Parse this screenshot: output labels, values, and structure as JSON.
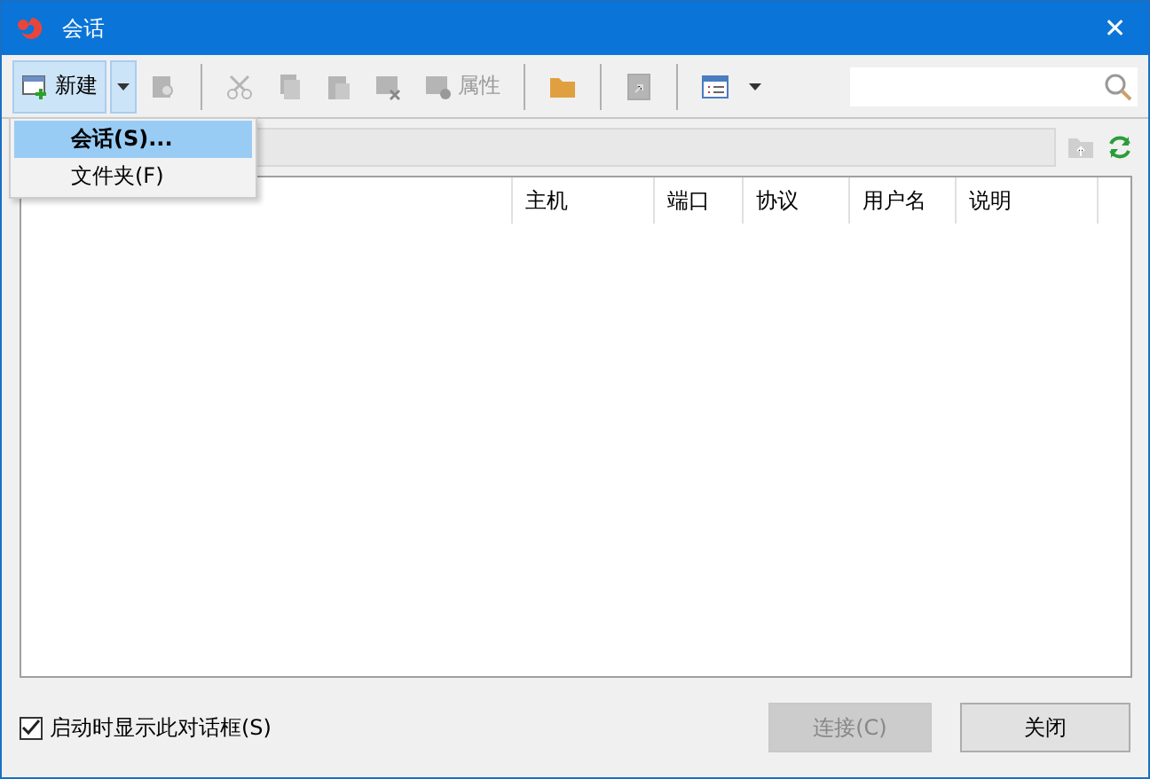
{
  "window": {
    "title": "会话",
    "close": "✕"
  },
  "toolbar": {
    "items": [
      {
        "kind": "new",
        "label": "新建",
        "pressed": true,
        "disabled": false
      },
      {
        "kind": "dropdown",
        "pressed": true,
        "disabled": false
      },
      {
        "kind": "find",
        "disabled": true
      },
      {
        "kind": "separator"
      },
      {
        "kind": "cut",
        "disabled": true
      },
      {
        "kind": "copy",
        "disabled": true
      },
      {
        "kind": "paste",
        "disabled": true
      },
      {
        "kind": "delete",
        "disabled": true
      },
      {
        "kind": "properties",
        "label": "属性",
        "disabled": true
      },
      {
        "kind": "separator"
      },
      {
        "kind": "folder",
        "disabled": false
      },
      {
        "kind": "separator"
      },
      {
        "kind": "shortcut",
        "disabled": true
      },
      {
        "kind": "separator"
      },
      {
        "kind": "view"
      },
      {
        "kind": "dropdown",
        "pressed": false
      }
    ]
  },
  "menu": {
    "items": [
      {
        "label": "会话(S)...",
        "selected": true
      },
      {
        "label": "文件夹(F)",
        "selected": false
      }
    ]
  },
  "table": {
    "columns": [
      "主机",
      "端口",
      "协议",
      "用户名",
      "说明"
    ]
  },
  "startup_checkbox": {
    "label": "启动时显示此对话框(S)",
    "checked": true
  },
  "buttons": [
    {
      "label": "连接(C)",
      "disabled": true
    },
    {
      "label": "关闭",
      "disabled": false
    }
  ]
}
